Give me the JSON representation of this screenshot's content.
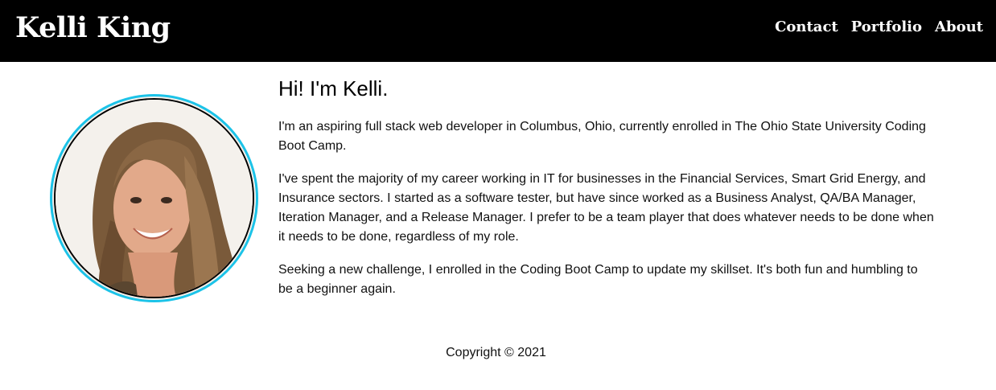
{
  "header": {
    "brand": "Kelli King",
    "nav": [
      {
        "label": "Contact"
      },
      {
        "label": "Portfolio"
      },
      {
        "label": "About"
      }
    ]
  },
  "about": {
    "heading": "Hi! I'm Kelli.",
    "paragraphs": [
      "I'm an aspiring full stack web developer in Columbus, Ohio, currently enrolled in The Ohio State University Coding Boot Camp.",
      "I've spent the majority of my career working in IT for businesses in the Financial Services, Smart Grid Energy, and Insurance sectors. I started as a software tester, but have since worked as a Business Analyst, QA/BA Manager, Iteration Manager, and a Release Manager. I prefer to be a team player that does whatever needs to be done when it needs to be done, regardless of my role.",
      "Seeking a new challenge, I enrolled in the Coding Boot Camp to update my skillset. It's both fun and humbling to be a beginner again."
    ]
  },
  "footer": {
    "copyright": "Copyright © 2021"
  },
  "colors": {
    "header_bg": "#000000",
    "avatar_ring": "#1cc3e8"
  },
  "icons": {
    "profile_photo": "profile-photo"
  }
}
